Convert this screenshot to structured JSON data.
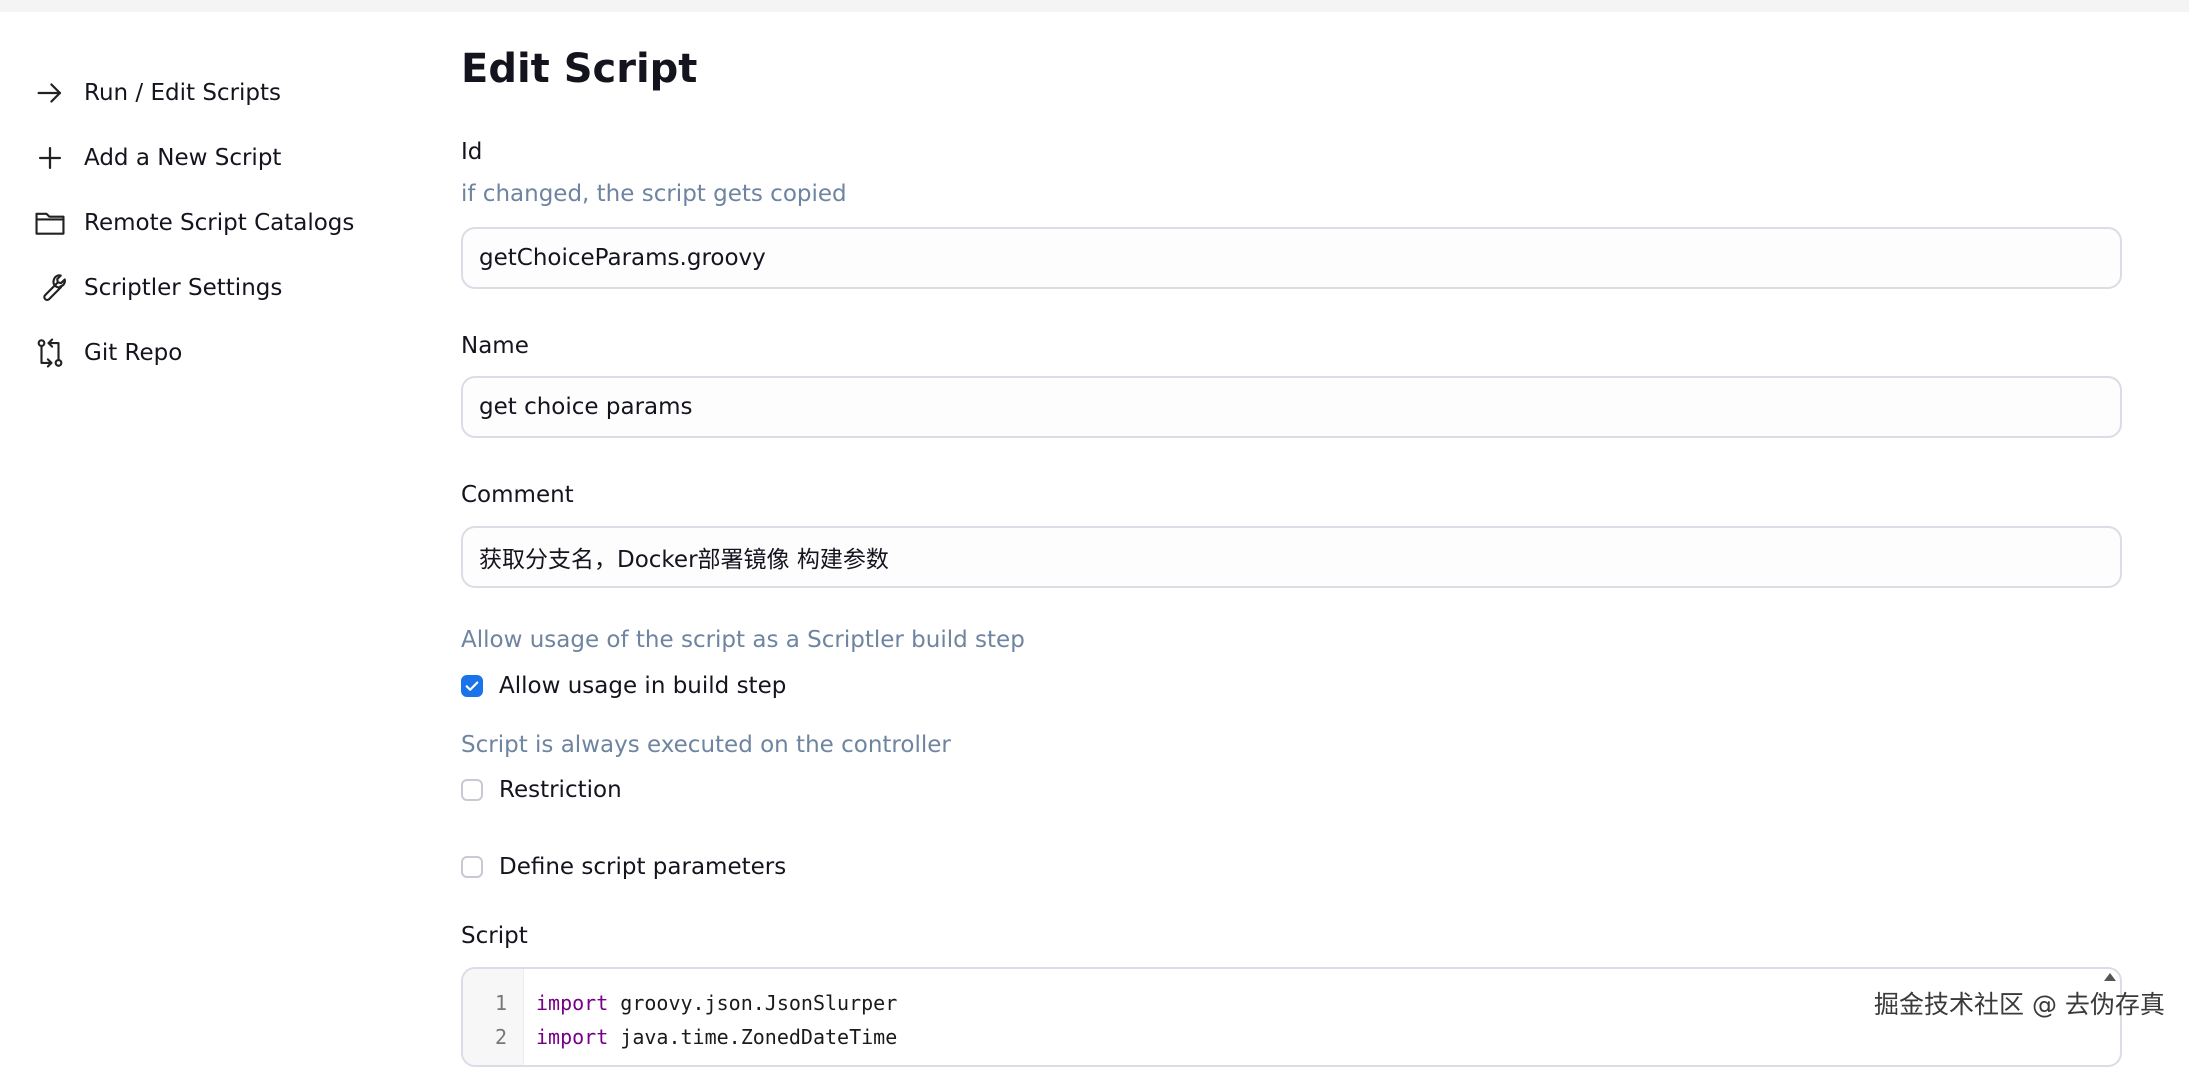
{
  "sidebar": {
    "items": [
      {
        "label": "Run / Edit Scripts",
        "icon": "arrow-right-icon"
      },
      {
        "label": "Add a New Script",
        "icon": "plus-icon"
      },
      {
        "label": "Remote Script Catalogs",
        "icon": "folder-icon"
      },
      {
        "label": "Scriptler Settings",
        "icon": "wrench-icon"
      },
      {
        "label": "Git Repo",
        "icon": "git-compare-icon"
      }
    ]
  },
  "page": {
    "title": "Edit Script"
  },
  "form": {
    "id": {
      "label": "Id",
      "description": "if changed, the script gets copied",
      "value": "getChoiceParams.groovy"
    },
    "name": {
      "label": "Name",
      "value": "get choice params"
    },
    "comment": {
      "label": "Comment",
      "value": "获取分支名，Docker部署镜像 构建参数"
    },
    "build_step": {
      "description": "Allow usage of the script as a Scriptler build step",
      "label": "Allow usage in build step",
      "checked": true
    },
    "restriction": {
      "description": "Script is always executed on the controller",
      "label": "Restriction",
      "checked": false
    },
    "parameters": {
      "label": "Define script parameters",
      "checked": false
    },
    "script": {
      "label": "Script",
      "lines": [
        {
          "no": "1",
          "keyword": "import",
          "rest": " groovy.json.JsonSlurper"
        },
        {
          "no": "2",
          "keyword": "import",
          "rest": " java.time.ZonedDateTime"
        }
      ]
    }
  },
  "watermark": "掘金技术社区 @ 去伪存真",
  "colors": {
    "accent": "#1a73e8",
    "description_text": "#6e84a0",
    "input_border": "#dbdde6"
  }
}
